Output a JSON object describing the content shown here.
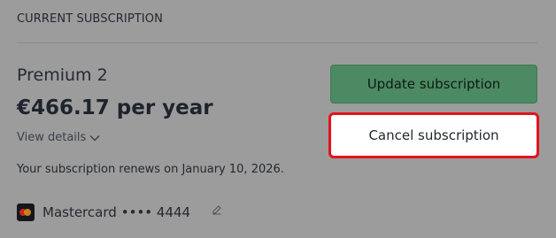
{
  "section": {
    "title": "CURRENT SUBSCRIPTION"
  },
  "plan": {
    "name": "Premium 2",
    "price": "€466.17 per year",
    "view_details_label": "View details",
    "renewal_text": "Your subscription renews on January 10, 2026."
  },
  "payment": {
    "card_brand": "Mastercard",
    "card_masked": "•••• 4444",
    "card_icon": "mastercard-icon",
    "edit_icon": "edit-icon"
  },
  "actions": {
    "update_label": "Update subscription",
    "cancel_label": "Cancel subscription"
  },
  "colors": {
    "accent_green": "#4b8a62",
    "highlight_red": "#e3131c"
  }
}
